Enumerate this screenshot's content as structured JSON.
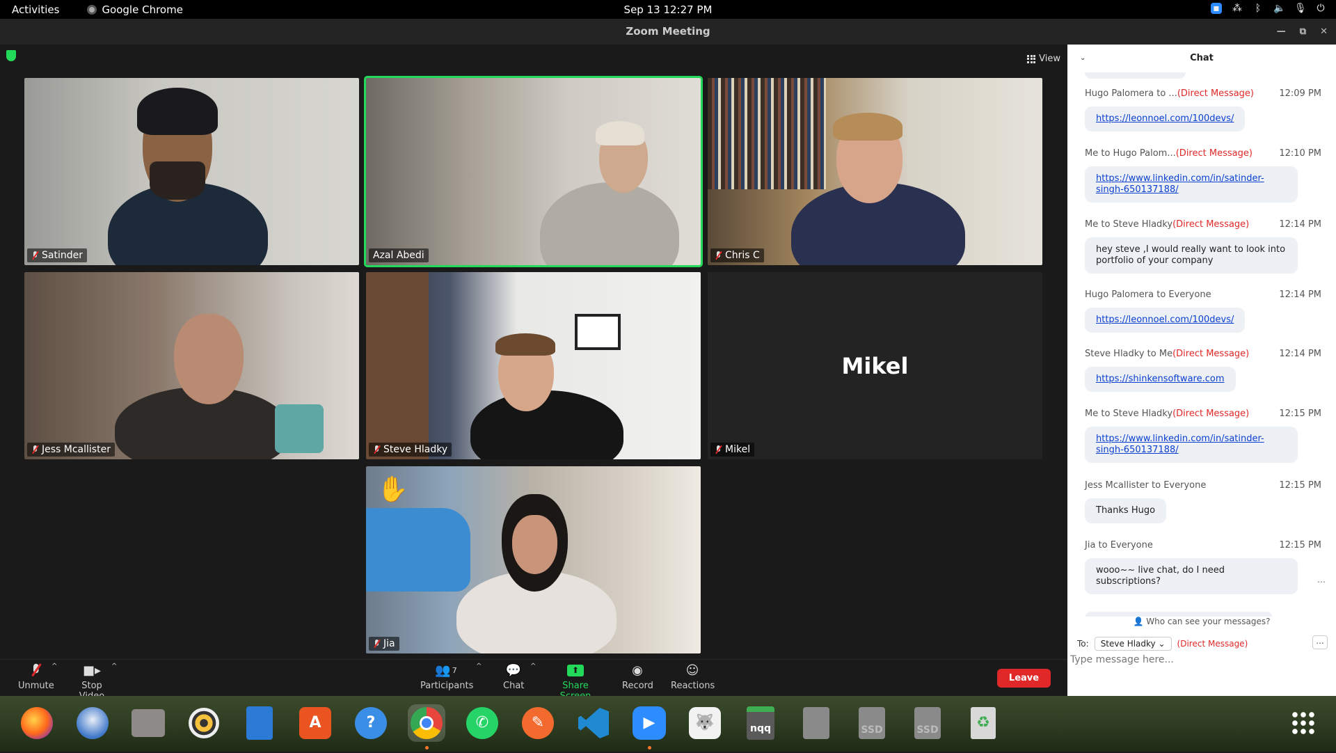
{
  "topbar": {
    "activities": "Activities",
    "app_name": "Google Chrome",
    "clock": "Sep 13  12:27 PM"
  },
  "window": {
    "title": "Zoom Meeting"
  },
  "view_button": "View",
  "participants": [
    {
      "name": "Satinder",
      "muted": true,
      "video": true
    },
    {
      "name": "Azal Abedi",
      "muted": false,
      "video": true,
      "active_speaker": true
    },
    {
      "name": "Chris C",
      "muted": true,
      "video": true
    },
    {
      "name": "Jess Mcallister",
      "muted": true,
      "video": true
    },
    {
      "name": "Steve Hladky",
      "muted": true,
      "video": true
    },
    {
      "name": "Mikel",
      "muted": true,
      "video": false,
      "display_name_big": "Mikel"
    },
    {
      "name": "Jia",
      "muted": true,
      "video": true,
      "raised_hand": true
    }
  ],
  "toolbar": {
    "unmute": "Unmute",
    "stop_video": "Stop Video",
    "participants": "Participants",
    "participants_count": "7",
    "chat": "Chat",
    "share_screen": "Share Screen",
    "record": "Record",
    "reactions": "Reactions",
    "leave": "Leave"
  },
  "chat": {
    "title": "Chat",
    "messages": [
      {
        "from": "Hugo Palomera to ...",
        "dm": "(Direct Message)",
        "time": "12:09 PM",
        "text": "https://leonnoel.com/100devs/",
        "link": true
      },
      {
        "from": "Me to Hugo Palom...",
        "dm": "(Direct Message)",
        "time": "12:10 PM",
        "text": "https://www.linkedin.com/in/satinder-singh-650137188/",
        "link": true
      },
      {
        "from": "Me to Steve Hladky",
        "dm": "(Direct Message)",
        "time": "12:14 PM",
        "text": "hey steve ,I would really want to look into portfolio of your company",
        "link": false
      },
      {
        "from": "Hugo Palomera to Everyone",
        "dm": "",
        "time": "12:14 PM",
        "text": "https://leonnoel.com/100devs/",
        "link": true
      },
      {
        "from": "Steve Hladky to Me",
        "dm": "(Direct Message)",
        "time": "12:14 PM",
        "text": "https://shinkensoftware.com",
        "link": true
      },
      {
        "from": "Me to Steve Hladky",
        "dm": "(Direct Message)",
        "time": "12:15 PM",
        "text": "https://www.linkedin.com/in/satinder-singh-650137188/",
        "link": true
      },
      {
        "from": "Jess Mcallister to Everyone",
        "dm": "",
        "time": "12:15 PM",
        "text": "Thanks Hugo",
        "link": false
      },
      {
        "from": "Jia to Everyone",
        "dm": "",
        "time": "12:15 PM",
        "text": "wooo~~ live chat, do I need subscriptions?",
        "link": false
      }
    ],
    "who_can_see": "Who can see your messages?",
    "to_label": "To:",
    "to_recipient": "Steve Hladky",
    "to_dm": "(Direct Message)",
    "more": "...",
    "input_placeholder": "Type message here..."
  },
  "dock": {
    "apps": [
      "firefox-icon",
      "thunderbird-icon",
      "files-icon",
      "rhythmbox-icon",
      "writer-icon",
      "app-center-icon",
      "help-icon",
      "chrome-icon",
      "whatsapp-icon",
      "pencil-app-icon",
      "vscode-icon",
      "zoom-icon",
      "gimp-icon",
      "nqq-icon",
      "disk-icon",
      "ssd-icon",
      "ssd-icon",
      "trash-icon",
      "app-grid-icon"
    ],
    "nqq_label": "nqq",
    "ssd_label": "SSD"
  }
}
